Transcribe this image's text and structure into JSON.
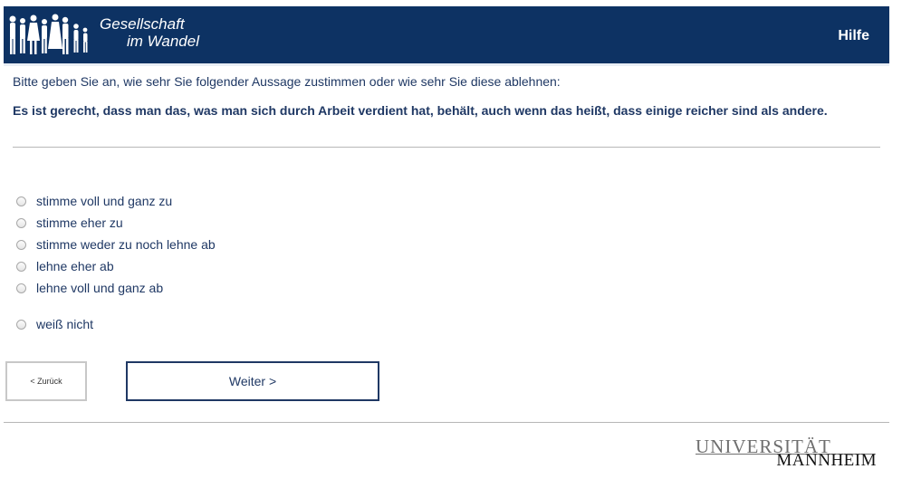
{
  "header": {
    "logo_line1": "Gesellschaft",
    "logo_line2": "im Wandel",
    "help_label": "Hilfe",
    "bg_color": "#0d3263"
  },
  "question": {
    "intro": "Bitte geben Sie an, wie sehr Sie folgender Aussage zustimmen oder wie sehr Sie diese ablehnen:",
    "statement": "Es ist gerecht, dass man das, was man sich durch Arbeit verdient hat, behält, auch wenn das heißt, dass einige reicher sind als andere."
  },
  "options": [
    {
      "label": "stimme voll und ganz zu",
      "selected": false
    },
    {
      "label": "stimme eher zu",
      "selected": false
    },
    {
      "label": "stimme weder zu noch lehne ab",
      "selected": false
    },
    {
      "label": "lehne eher ab",
      "selected": false
    },
    {
      "label": "lehne voll und ganz ab",
      "selected": false
    },
    {
      "label": "weiß nicht",
      "selected": false
    }
  ],
  "nav": {
    "back_label": "< Zurück",
    "next_label": "Weiter >"
  },
  "footer": {
    "uni_line1": "UNIVERSITÄT",
    "uni_line2": "MANNHEIM"
  }
}
